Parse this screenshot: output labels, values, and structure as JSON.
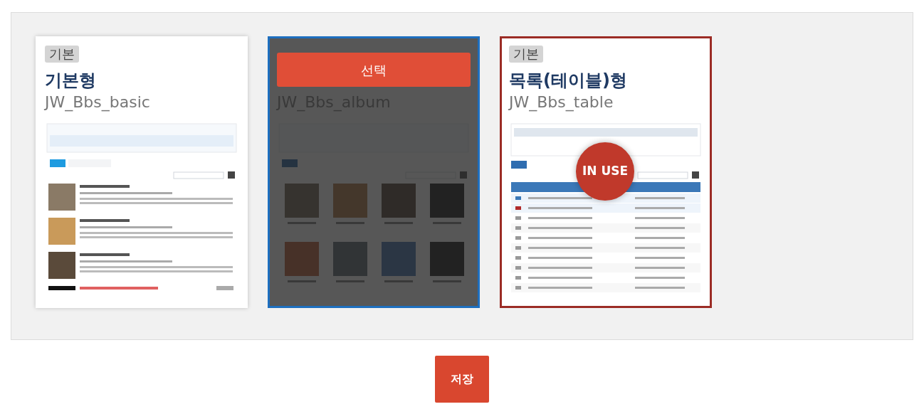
{
  "skins": [
    {
      "badge": "기본",
      "title": "기본형",
      "code": "JW_Bbs_basic",
      "kind": "list",
      "hovered": false,
      "in_use": false
    },
    {
      "code": "JW_Bbs_album",
      "kind": "album",
      "hovered": true,
      "in_use": false,
      "select_label": "선택"
    },
    {
      "badge": "기본",
      "title": "목록(테이블)형",
      "code": "JW_Bbs_table",
      "kind": "table",
      "hovered": false,
      "in_use": true,
      "in_use_label": "IN USE"
    }
  ],
  "save_button": "저장"
}
